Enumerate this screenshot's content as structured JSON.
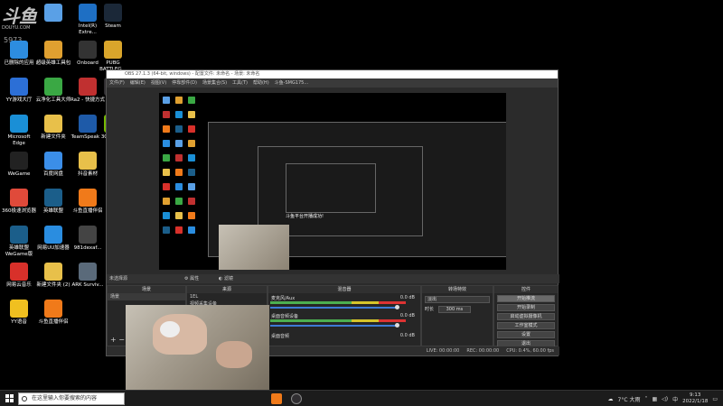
{
  "watermark": {
    "logo": "斗鱼",
    "sub": "DOUYU.COM",
    "room_id": "5973"
  },
  "desktop_icons": [
    {
      "label": "",
      "color": "#5aa0e6"
    },
    {
      "label": "Intel(R) Extre...",
      "color": "#1e6fc4"
    },
    {
      "label": "Steam",
      "color": "#1b2838"
    },
    {
      "label": "已删除的应用",
      "color": "#2d8de0"
    },
    {
      "label": "超级英雄工具包",
      "color": "#e0a030"
    },
    {
      "label": "Onboard",
      "color": "#333333"
    },
    {
      "label": "PUBG BATTLEG...",
      "color": "#d9a52b"
    },
    {
      "label": "YY游戏大厅",
      "color": "#2c6fd6"
    },
    {
      "label": "云净化工具大师",
      "color": "#3aa844"
    },
    {
      "label": "Ra2 - 快捷方式",
      "color": "#c03030"
    },
    {
      "label": "OBS",
      "color": "#302e31"
    },
    {
      "label": "Microsoft Edge",
      "color": "#1a8fd6"
    },
    {
      "label": "新建文件夹",
      "color": "#e8c04a"
    },
    {
      "label": "TeamSpeak 3",
      "color": "#1e5aa8"
    },
    {
      "label": "Ge Exp",
      "color": "#76b900"
    },
    {
      "label": "WeGame",
      "color": "#222222"
    },
    {
      "label": "百度网盘",
      "color": "#3b8ee8"
    },
    {
      "label": "抖音素材",
      "color": "#e8c04a"
    },
    {
      "label": "斗鱼直播",
      "color": "#f07a1a"
    },
    {
      "label": "360极速浏览器",
      "color": "#e04a3a"
    },
    {
      "label": "英雄联盟",
      "color": "#1b5e8a"
    },
    {
      "label": "斗鱼直播伴侣",
      "color": "#f07a1a"
    },
    {
      "label": "桌面小工具",
      "color": "#d0d0d0"
    },
    {
      "label": "英雄联盟 WeGame版",
      "color": "#1b5e8a"
    },
    {
      "label": "网易UU加速器",
      "color": "#2a8de0"
    },
    {
      "label": "981dexaf...",
      "color": "#444444"
    },
    {
      "label": "Launcher...",
      "color": "#c8302a"
    },
    {
      "label": "网易云音乐",
      "color": "#d8302a"
    },
    {
      "label": "新建文件夹 (2)",
      "color": "#e8c04a"
    },
    {
      "label": "ARK Surviv...",
      "color": "#5a6a7a"
    },
    {
      "label": "英雄联盟 WeGame版",
      "color": "#1b5e8a"
    },
    {
      "label": "YY语音",
      "color": "#f0c020"
    },
    {
      "label": "斗鱼直播伴侣",
      "color": "#f07a1a"
    }
  ],
  "obs": {
    "title": "OBS 27.1.3 (64-bit, windows) - 配置文件: 未命名 - 场景: 未命名",
    "menu": [
      "文件(F)",
      "编辑(E)",
      "视图(V)",
      "停靠部件(D)",
      "场景集合(S)",
      "工具(T)",
      "帮助(H)",
      "斗鱼-SMG175..."
    ],
    "dock_label": "未选择源",
    "properties": "属性",
    "filters": "滤镜",
    "panels": {
      "scenes": {
        "title": "场景",
        "items": [
          "场景"
        ]
      },
      "sources": {
        "title": "来源",
        "items": [
          "1EL",
          "视频采集设备"
        ]
      },
      "mixer": {
        "title": "混音器",
        "tracks": [
          {
            "name": "麦克风/Aux",
            "db": "0.0 dB"
          },
          {
            "name": "桌面音频设备",
            "db": "0.0 dB"
          },
          {
            "name": "桌面音频",
            "db": "0.0 dB"
          }
        ]
      },
      "transitions": {
        "title": "转场特效",
        "type": "淡出",
        "duration_label": "时长",
        "duration": "300 ms"
      },
      "controls": {
        "title": "控件",
        "buttons": [
          "开始推流",
          "开始录制",
          "启动虚拟摄像机",
          "工作室模式",
          "设置",
          "退出"
        ]
      }
    },
    "status": {
      "live": "LIVE: 00:00:00",
      "rec": "REC: 00:00:00",
      "cpu": "CPU: 0.4%, 60.00 fps"
    },
    "nested_title": "斗鱼平台开播成功!"
  },
  "taskbar": {
    "search_placeholder": "在这里输入你要搜索的内容",
    "weather": "7°C 大雨",
    "time": "9:13",
    "date": "2022/1/18",
    "lang": "中"
  }
}
